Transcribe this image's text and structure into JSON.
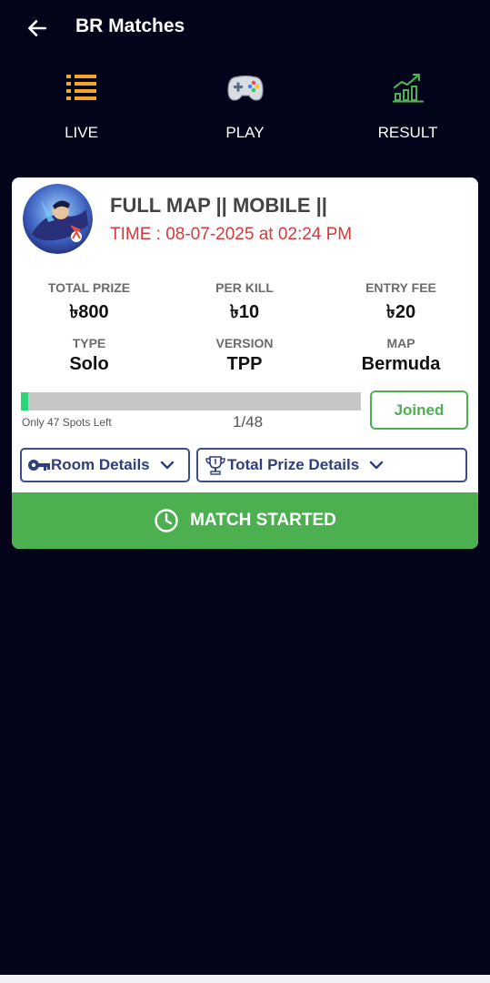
{
  "header": {
    "title": "BR Matches"
  },
  "tabs": [
    {
      "label": "LIVE",
      "icon": "list-icon",
      "color": "#f5a623"
    },
    {
      "label": "PLAY",
      "icon": "gamepad-icon",
      "active": true
    },
    {
      "label": "RESULT",
      "icon": "chart-growth-icon",
      "color": "#4caf50"
    }
  ],
  "match": {
    "title": "FULL MAP || MOBILE ||",
    "time": "TIME : 08-07-2025 at 02:24 PM",
    "stats": {
      "total_prize": {
        "label": "TOTAL PRIZE",
        "value": "৳800"
      },
      "per_kill": {
        "label": "PER KILL",
        "value": "৳10"
      },
      "entry_fee": {
        "label": "ENTRY FEE",
        "value": "৳20"
      },
      "type": {
        "label": "TYPE",
        "value": "Solo"
      },
      "version": {
        "label": "VERSION",
        "value": "TPP"
      },
      "map": {
        "label": "MAP",
        "value": "Bermuda"
      }
    },
    "progress": {
      "joined": 1,
      "total": 48,
      "fraction": 0.0208
    },
    "spots_left": "Only 47 Spots Left",
    "spots_count": "1/48",
    "joined_label": "Joined",
    "room_details_label": "Room Details",
    "prize_details_label": "Total Prize Details",
    "status_label": "MATCH STARTED"
  },
  "colors": {
    "background": "#03031a",
    "accent_green": "#4caf50",
    "time_red": "#d63a3a",
    "progress_fill": "#2bd67b",
    "button_blue": "#2e3f7d"
  }
}
